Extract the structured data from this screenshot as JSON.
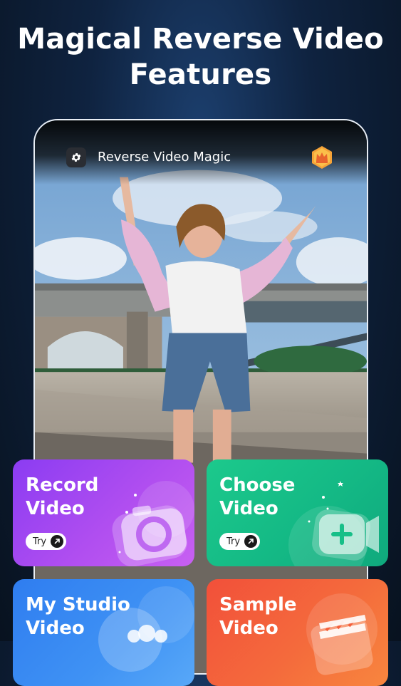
{
  "headline": {
    "line1": "Magical Reverse Video",
    "line2": "Features"
  },
  "app": {
    "title": "Reverse Video Magic",
    "icons": {
      "settings": "gear-icon",
      "premium": "crown-icon"
    }
  },
  "cards": {
    "record": {
      "line1": "Record",
      "line2": "Video",
      "try": "Try",
      "icon": "camera-icon"
    },
    "choose": {
      "line1": "Choose",
      "line2": "Video",
      "try": "Try",
      "icon": "video-add-icon"
    },
    "studio": {
      "line1": "My Studio",
      "line2": "Video",
      "icon": "film-reel-icon"
    },
    "sample": {
      "line1": "Sample",
      "line2": "Video",
      "icon": "clapperboard-icon"
    }
  },
  "colors": {
    "record": "#a648f0",
    "choose": "#17bf88",
    "studio": "#3a8cf2",
    "sample": "#f4603b",
    "premium": "#f6a338"
  }
}
